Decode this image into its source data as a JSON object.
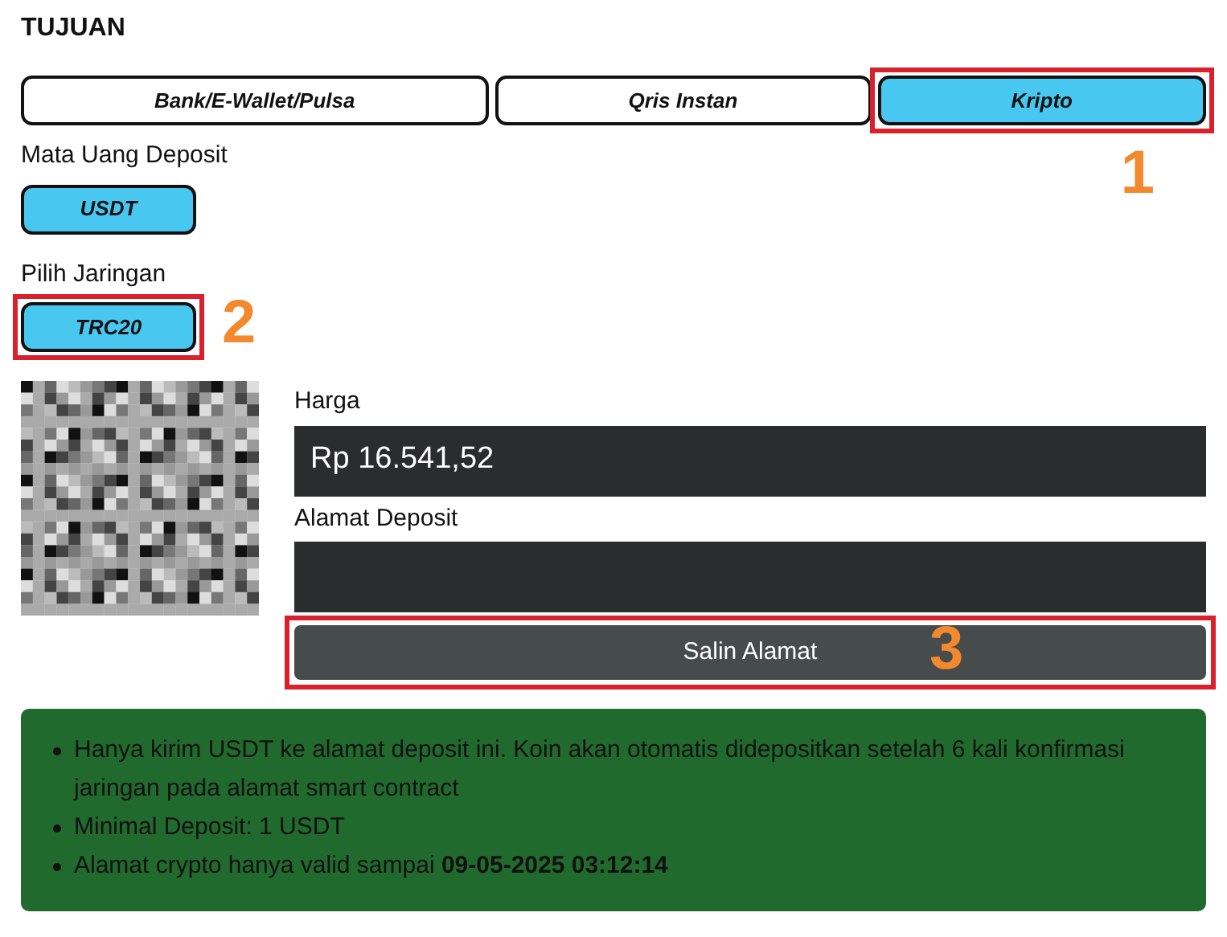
{
  "heading": "TUJUAN",
  "tabs": [
    {
      "label": "Bank/E-Wallet/Pulsa",
      "selected": false
    },
    {
      "label": "Qris Instan",
      "selected": false
    },
    {
      "label": "Kripto",
      "selected": true,
      "callout": "1"
    }
  ],
  "currency": {
    "label": "Mata Uang Deposit",
    "options": [
      {
        "label": "USDT",
        "selected": true
      }
    ]
  },
  "network": {
    "label": "Pilih Jaringan",
    "options": [
      {
        "label": "TRC20",
        "selected": true,
        "callout": "2"
      }
    ]
  },
  "price": {
    "label": "Harga",
    "value": "Rp 16.541,52"
  },
  "address": {
    "label": "Alamat Deposit"
  },
  "copy_button": {
    "label": "Salin Alamat",
    "callout": "3"
  },
  "notes": [
    "Hanya kirim USDT ke alamat deposit ini. Koin akan otomatis didepositkan setelah 6 kali konfirmasi jaringan pada alamat smart contract",
    "Minimal Deposit: 1 USDT",
    "Alamat crypto hanya valid sampai **09-05-2025 03:12:14**"
  ]
}
